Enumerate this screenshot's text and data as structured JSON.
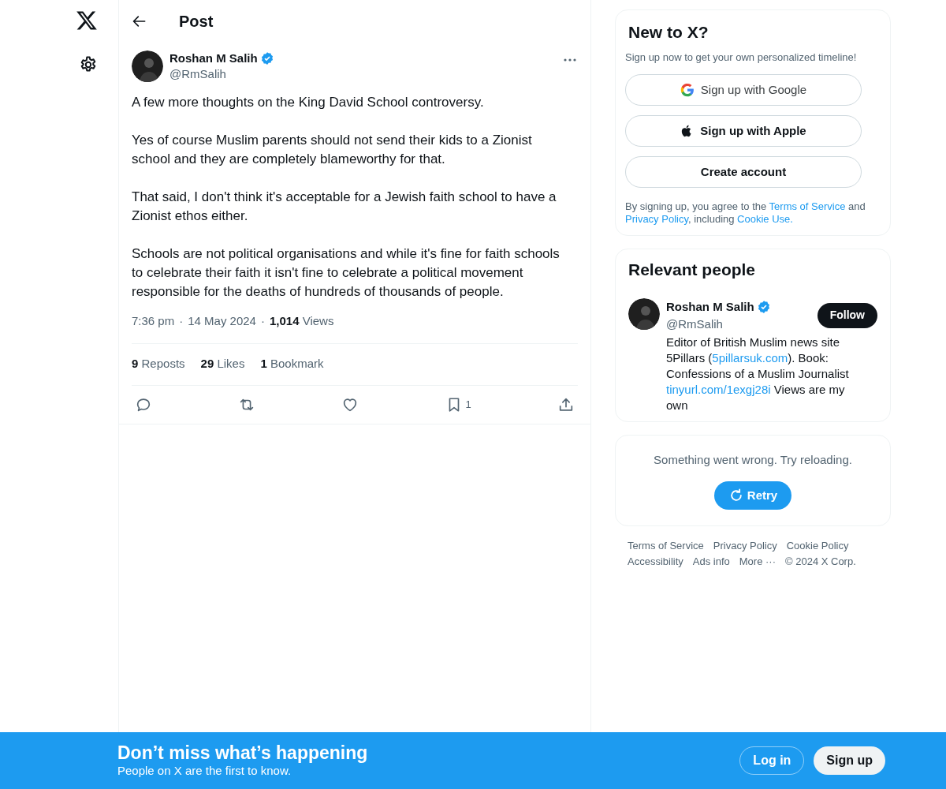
{
  "header": {
    "title": "Post"
  },
  "post": {
    "author": {
      "name": "Roshan M Salih",
      "handle": "@RmSalih",
      "verified": true
    },
    "paragraphs": [
      "A few more thoughts on the King David School controversy.",
      "Yes of course Muslim parents should not send their kids to a Zionist school and they are completely blameworthy for that.",
      "That said, I don't think it's acceptable for a Jewish faith school to have a Zionist ethos either.",
      "Schools are not political organisations and while it's fine for faith schools to celebrate their faith it isn't fine to celebrate a political movement responsible for the deaths of hundreds of thousands of people."
    ],
    "time": "7:36 pm",
    "separator": "·",
    "date": "14 May 2024",
    "views_count": "1,014",
    "views_label": "Views",
    "stats": [
      {
        "count": "9",
        "label": "Reposts"
      },
      {
        "count": "29",
        "label": "Likes"
      },
      {
        "count": "1",
        "label": "Bookmark"
      }
    ],
    "actions": [
      {
        "kind": "reply"
      },
      {
        "kind": "repost"
      },
      {
        "kind": "like"
      },
      {
        "kind": "bookmark",
        "count": "1"
      },
      {
        "kind": "share"
      }
    ]
  },
  "signup": {
    "title": "New to X?",
    "subtitle": "Sign up now to get your own personalized timeline!",
    "buttons": [
      {
        "kind": "google",
        "label": "Sign up with Google"
      },
      {
        "kind": "apple",
        "label": "Sign up with Apple"
      },
      {
        "kind": "plain",
        "label": "Create account"
      }
    ],
    "legal": [
      {
        "text": "By signing up, you agree to the ",
        "link": false
      },
      {
        "text": "Terms of Service",
        "link": true
      },
      {
        "text": " and ",
        "link": false
      },
      {
        "text": "Privacy Policy",
        "link": true
      },
      {
        "text": ", including ",
        "link": false
      },
      {
        "text": "Cookie Use.",
        "link": true
      }
    ]
  },
  "relevant": {
    "title": "Relevant people",
    "person": {
      "name": "Roshan M Salih",
      "handle": "@RmSalih",
      "verified": true,
      "follow_label": "Follow",
      "bio": [
        {
          "text": "Editor of British Muslim news site 5Pillars (",
          "link": false
        },
        {
          "text": "5pillarsuk.com",
          "link": true
        },
        {
          "text": "). Book: Confessions of a Muslim Journalist ",
          "link": false
        },
        {
          "text": "tinyurl.com/1exgj28i",
          "link": true
        },
        {
          "text": " Views are my own",
          "link": false
        }
      ]
    }
  },
  "error": {
    "message": "Something went wrong. Try reloading.",
    "retry_label": "Retry"
  },
  "footer_links": [
    "Terms of Service",
    "Privacy Policy",
    "Cookie Policy",
    "Accessibility",
    "Ads info",
    "More ···",
    "© 2024 X Corp."
  ],
  "banner": {
    "title": "Don’t miss what’s happening",
    "subtitle": "People on X are the first to know.",
    "login": "Log in",
    "signup": "Sign up"
  }
}
